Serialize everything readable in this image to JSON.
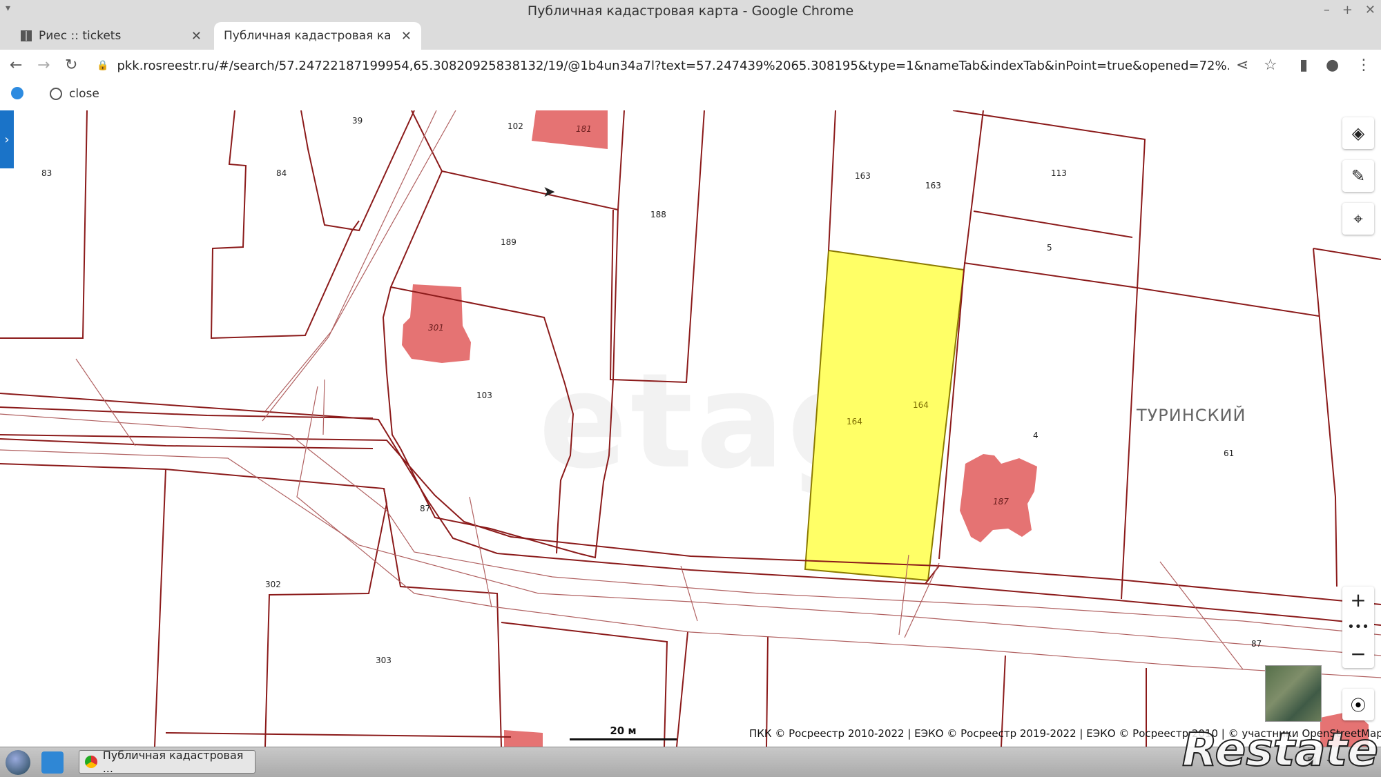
{
  "window": {
    "title": "Публичная кадастровая карта - Google Chrome"
  },
  "tabs": [
    {
      "label": "Риес :: tickets",
      "active": false
    },
    {
      "label": "Публичная кадастровая ка",
      "active": true
    }
  ],
  "address": {
    "url": "pkk.rosreestr.ru/#/search/57.24722187199954,65.30820925838132/19/@1b4un34a7l?text=57.247439%2065.308195&type=1&nameTab&indexTab&inPoint=true&opened=72%..."
  },
  "bookmarks": [
    {
      "label": "close"
    }
  ],
  "map": {
    "watermark": "etagi",
    "street_label": "ТУРИНСКИЙ",
    "parcel_labels": [
      "39",
      "83",
      "84",
      "102",
      "188",
      "189",
      "163",
      "163",
      "113",
      "5",
      "103",
      "87",
      "302",
      "303",
      "4",
      "61",
      "87"
    ],
    "building_labels": [
      "181",
      "301",
      "187"
    ],
    "selected_parcel_labels": [
      "164",
      "164"
    ],
    "scale": "20 м",
    "attribution": "ПКК © Росреестр 2010-2022 | ЕЭКО © Росреестр 2019-2022 | ЕЭКО © Росреестр 2010 | © участники OpenStreetMap",
    "colors": {
      "boundary": "#8b1a1a",
      "building": "#e57373",
      "selected": "#ffff66",
      "selected_border": "#8b7a00"
    }
  },
  "taskbar": {
    "task_label": "Публичная кадастровая ..."
  },
  "overlay_logo": "Restate"
}
